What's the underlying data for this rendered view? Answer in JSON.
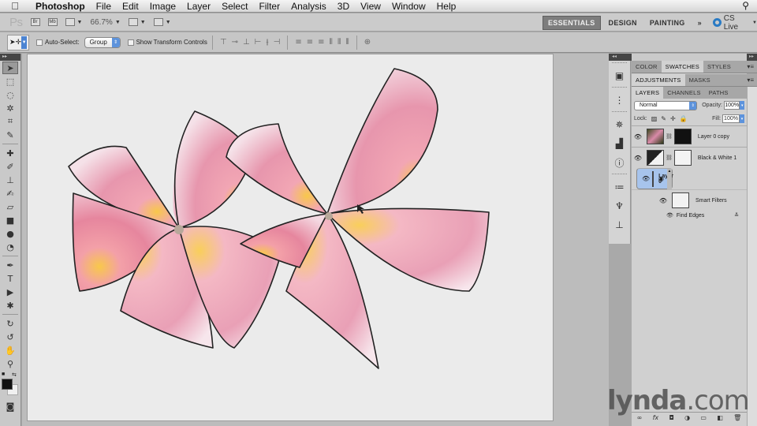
{
  "menubar": {
    "app_name": "Photoshop",
    "items": [
      "File",
      "Edit",
      "Image",
      "Layer",
      "Select",
      "Filter",
      "Analysis",
      "3D",
      "View",
      "Window",
      "Help"
    ]
  },
  "appbar": {
    "logo": "Ps",
    "bridge": "Br",
    "minibridge": "Mb",
    "zoom": "66.7%",
    "workspaces": [
      "ESSENTIALS",
      "DESIGN",
      "PAINTING"
    ],
    "active_workspace": "ESSENTIALS",
    "more": "»",
    "cs_live": "CS Live"
  },
  "options": {
    "auto_select_label": "Auto-Select:",
    "auto_select_checked": false,
    "auto_select_target": "Group",
    "show_transform_label": "Show Transform Controls",
    "show_transform_checked": false
  },
  "tools": [
    {
      "name": "move-tool",
      "glyph": "➤"
    },
    {
      "name": "marquee-tool",
      "glyph": "⬚"
    },
    {
      "name": "lasso-tool",
      "glyph": "◌"
    },
    {
      "name": "quick-selection-tool",
      "glyph": "✲"
    },
    {
      "name": "crop-tool",
      "glyph": "⌗"
    },
    {
      "name": "eyedropper-tool",
      "glyph": "✎"
    },
    {
      "name": "healing-brush-tool",
      "glyph": "✚"
    },
    {
      "name": "brush-tool",
      "glyph": "✐"
    },
    {
      "name": "clone-stamp-tool",
      "glyph": "⊥"
    },
    {
      "name": "history-brush-tool",
      "glyph": "✍"
    },
    {
      "name": "eraser-tool",
      "glyph": "▱"
    },
    {
      "name": "gradient-tool",
      "glyph": "■"
    },
    {
      "name": "blur-tool",
      "glyph": "●"
    },
    {
      "name": "dodge-tool",
      "glyph": "◔"
    },
    {
      "name": "pen-tool",
      "glyph": "✒"
    },
    {
      "name": "type-tool",
      "glyph": "T"
    },
    {
      "name": "path-selection-tool",
      "glyph": "▶"
    },
    {
      "name": "custom-shape-tool",
      "glyph": "✱"
    },
    {
      "name": "3d-rotate-tool",
      "glyph": "↻"
    },
    {
      "name": "3d-orbit-tool",
      "glyph": "↺"
    },
    {
      "name": "hand-tool",
      "glyph": "✋"
    },
    {
      "name": "zoom-tool",
      "glyph": "⚲"
    }
  ],
  "colors": {
    "foreground": "#111111",
    "background": "#f0f0f0"
  },
  "panels": {
    "group1_tabs": [
      "COLOR",
      "SWATCHES",
      "STYLES"
    ],
    "group1_active": "SWATCHES",
    "group2_tabs": [
      "ADJUSTMENTS",
      "MASKS"
    ],
    "group2_active": "ADJUSTMENTS",
    "group3_tabs": [
      "LAYERS",
      "CHANNELS",
      "PATHS"
    ],
    "group3_active": "LAYERS"
  },
  "layers_panel": {
    "blend_mode": "Normal",
    "opacity_label": "Opacity:",
    "opacity": "100%",
    "lock_label": "Lock:",
    "fill_label": "Fill:",
    "fill": "100%",
    "layers": [
      {
        "name": "Layer 0 copy",
        "visible": true,
        "selected": false
      },
      {
        "name": "Black & White 1",
        "visible": true,
        "selected": false
      },
      {
        "name": "Layer 0",
        "visible": true,
        "selected": true
      }
    ],
    "smart_filters_label": "Smart Filters",
    "filters": [
      "Find Edges"
    ]
  },
  "watermark": {
    "brand": "lynda",
    ".com": ".com"
  }
}
